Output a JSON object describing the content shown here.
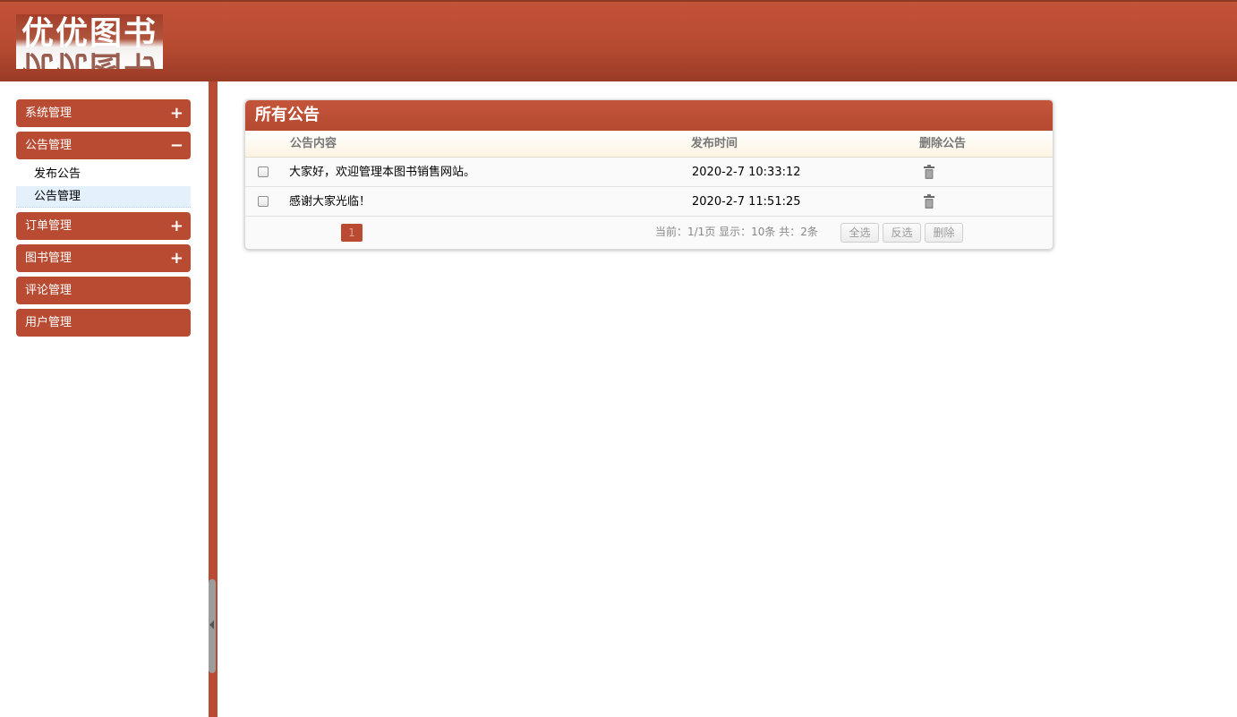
{
  "header": {
    "logo_text": "优优图书"
  },
  "sidebar": {
    "menus": [
      {
        "label": "系统管理",
        "sign": "+"
      },
      {
        "label": "公告管理",
        "sign": "−"
      },
      {
        "label": "订单管理",
        "sign": "+"
      },
      {
        "label": "图书管理",
        "sign": "+"
      },
      {
        "label": "评论管理",
        "sign": ""
      },
      {
        "label": "用户管理",
        "sign": ""
      }
    ],
    "sub_items": [
      {
        "label": "发布公告",
        "active": false
      },
      {
        "label": "公告管理",
        "active": true
      }
    ]
  },
  "panel": {
    "title": "所有公告",
    "columns": [
      "公告内容",
      "发布时间",
      "删除公告"
    ],
    "rows": [
      {
        "content": "大家好，欢迎管理本图书销售网站。",
        "time": "2020-2-7 10:33:12"
      },
      {
        "content": "感谢大家光临！",
        "time": "2020-2-7 11:51:25"
      }
    ]
  },
  "pager": {
    "current_page": "1",
    "info": "当前：1/1页  显示：10条  共：2条",
    "select_all": "全选",
    "invert": "反选",
    "delete": "删除"
  },
  "colors": {
    "brand": "#b94b33",
    "active_sub": "#e4f0fb"
  }
}
